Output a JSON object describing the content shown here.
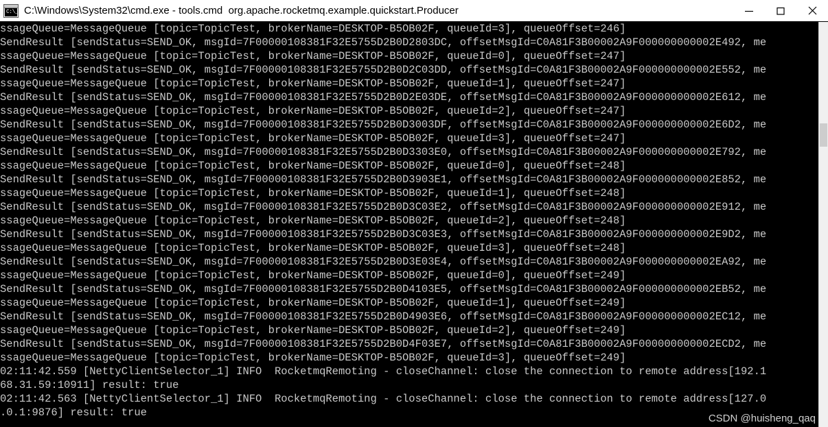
{
  "window": {
    "title": "C:\\Windows\\System32\\cmd.exe - tools.cmd  org.apache.rocketmq.example.quickstart.Producer",
    "icon_name": "cmd-console-icon",
    "icon_glyph": "C:\\_",
    "background": "#000000",
    "text_color": "#c9c9c9",
    "titlebar_background": "#ffffff",
    "titlebar_text_color": "#000000"
  },
  "controls": {
    "minimize_label": "Minimize",
    "maximize_label": "Maximize",
    "close_label": "Close"
  },
  "scrollbar": {
    "track_color": "#f0f0f0",
    "thumb_color": "#cdcdcd"
  },
  "watermark": {
    "text": "CSDN @huisheng_qaq",
    "color": "#d2d2d2"
  },
  "console": {
    "font_size_px": 15.5,
    "line_height_px": 20,
    "lines": [
      "ssageQueue=MessageQueue [topic=TopicTest, brokerName=DESKTOP-B5OB02F, queueId=3], queueOffset=246]",
      "SendResult [sendStatus=SEND_OK, msgId=7F00000108381F32E5755D2B0D2803DC, offsetMsgId=C0A81F3B00002A9F000000000002E492, me",
      "ssageQueue=MessageQueue [topic=TopicTest, brokerName=DESKTOP-B5OB02F, queueId=0], queueOffset=247]",
      "SendResult [sendStatus=SEND_OK, msgId=7F00000108381F32E5755D2B0D2C03DD, offsetMsgId=C0A81F3B00002A9F000000000002E552, me",
      "ssageQueue=MessageQueue [topic=TopicTest, brokerName=DESKTOP-B5OB02F, queueId=1], queueOffset=247]",
      "SendResult [sendStatus=SEND_OK, msgId=7F00000108381F32E5755D2B0D2E03DE, offsetMsgId=C0A81F3B00002A9F000000000002E612, me",
      "ssageQueue=MessageQueue [topic=TopicTest, brokerName=DESKTOP-B5OB02F, queueId=2], queueOffset=247]",
      "SendResult [sendStatus=SEND_OK, msgId=7F00000108381F32E5755D2B0D3003DF, offsetMsgId=C0A81F3B00002A9F000000000002E6D2, me",
      "ssageQueue=MessageQueue [topic=TopicTest, brokerName=DESKTOP-B5OB02F, queueId=3], queueOffset=247]",
      "SendResult [sendStatus=SEND_OK, msgId=7F00000108381F32E5755D2B0D3303E0, offsetMsgId=C0A81F3B00002A9F000000000002E792, me",
      "ssageQueue=MessageQueue [topic=TopicTest, brokerName=DESKTOP-B5OB02F, queueId=0], queueOffset=248]",
      "SendResult [sendStatus=SEND_OK, msgId=7F00000108381F32E5755D2B0D3903E1, offsetMsgId=C0A81F3B00002A9F000000000002E852, me",
      "ssageQueue=MessageQueue [topic=TopicTest, brokerName=DESKTOP-B5OB02F, queueId=1], queueOffset=248]",
      "SendResult [sendStatus=SEND_OK, msgId=7F00000108381F32E5755D2B0D3C03E2, offsetMsgId=C0A81F3B00002A9F000000000002E912, me",
      "ssageQueue=MessageQueue [topic=TopicTest, brokerName=DESKTOP-B5OB02F, queueId=2], queueOffset=248]",
      "SendResult [sendStatus=SEND_OK, msgId=7F00000108381F32E5755D2B0D3C03E3, offsetMsgId=C0A81F3B00002A9F000000000002E9D2, me",
      "ssageQueue=MessageQueue [topic=TopicTest, brokerName=DESKTOP-B5OB02F, queueId=3], queueOffset=248]",
      "SendResult [sendStatus=SEND_OK, msgId=7F00000108381F32E5755D2B0D3E03E4, offsetMsgId=C0A81F3B00002A9F000000000002EA92, me",
      "ssageQueue=MessageQueue [topic=TopicTest, brokerName=DESKTOP-B5OB02F, queueId=0], queueOffset=249]",
      "SendResult [sendStatus=SEND_OK, msgId=7F00000108381F32E5755D2B0D4103E5, offsetMsgId=C0A81F3B00002A9F000000000002EB52, me",
      "ssageQueue=MessageQueue [topic=TopicTest, brokerName=DESKTOP-B5OB02F, queueId=1], queueOffset=249]",
      "SendResult [sendStatus=SEND_OK, msgId=7F00000108381F32E5755D2B0D4903E6, offsetMsgId=C0A81F3B00002A9F000000000002EC12, me",
      "ssageQueue=MessageQueue [topic=TopicTest, brokerName=DESKTOP-B5OB02F, queueId=2], queueOffset=249]",
      "SendResult [sendStatus=SEND_OK, msgId=7F00000108381F32E5755D2B0D4F03E7, offsetMsgId=C0A81F3B00002A9F000000000002ECD2, me",
      "ssageQueue=MessageQueue [topic=TopicTest, brokerName=DESKTOP-B5OB02F, queueId=3], queueOffset=249]",
      "02:11:42.559 [NettyClientSelector_1] INFO  RocketmqRemoting - closeChannel: close the connection to remote address[192.1",
      "68.31.59:10911] result: true",
      "02:11:42.563 [NettyClientSelector_1] INFO  RocketmqRemoting - closeChannel: close the connection to remote address[127.0",
      ".0.1:9876] result: true"
    ]
  }
}
